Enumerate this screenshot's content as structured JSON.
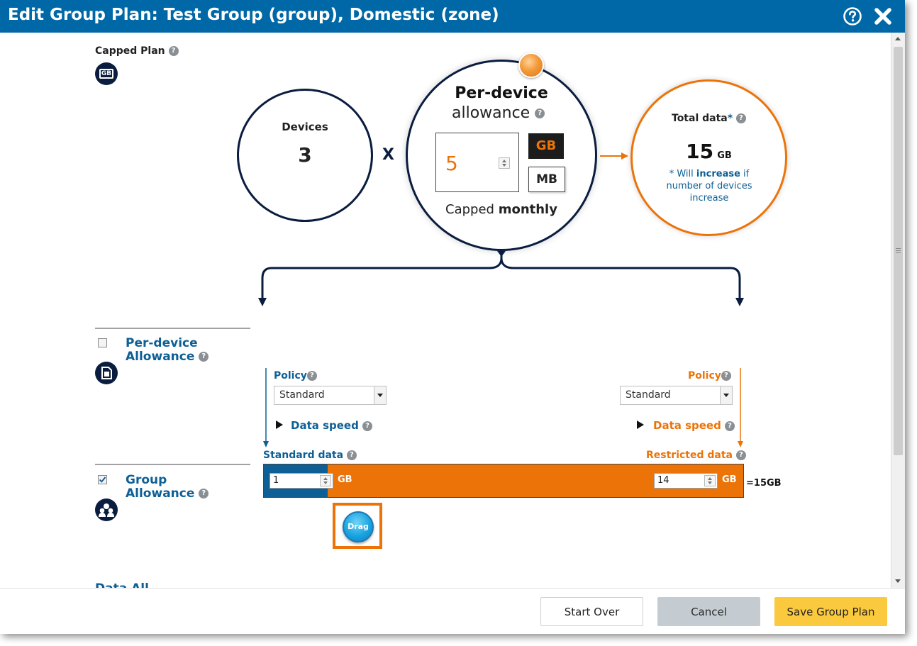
{
  "window": {
    "title": "Edit Group Plan: Test Group (group), Domestic (zone)"
  },
  "plan": {
    "type_label": "Capped Plan",
    "badge": "GB"
  },
  "devices": {
    "label": "Devices",
    "count": "3"
  },
  "operator": "X",
  "per_device": {
    "title": "Per-device",
    "subtitle": "allowance",
    "amount": "5",
    "unit_gb": "GB",
    "unit_mb": "MB",
    "period_prefix": "Capped",
    "period": "monthly"
  },
  "total": {
    "label": "Total data",
    "asterisk": "*",
    "value": "15",
    "unit": "GB",
    "note_prefix": "* Will",
    "note_bold": "increase",
    "note_suffix": "if number of devices increase"
  },
  "sections": {
    "per_device": {
      "line1": "Per-device",
      "line2": "Allowance",
      "checked": false
    },
    "group": {
      "line1": "Group",
      "line2": "Allowance",
      "checked": true
    },
    "cut_off": "Data All"
  },
  "standard": {
    "policy_label": "Policy",
    "policy_value": "Standard",
    "speed_label": "Data speed",
    "data_label": "Standard data",
    "amount": "1",
    "unit": "GB"
  },
  "restricted": {
    "policy_label": "Policy",
    "policy_value": "Standard",
    "speed_label": "Data speed",
    "data_label": "Restricted data",
    "amount": "14",
    "unit": "GB"
  },
  "bar": {
    "total_label": "=15GB",
    "drag_label": "Drag",
    "standard_share": 0.0667
  },
  "footer": {
    "start_over": "Start Over",
    "cancel": "Cancel",
    "save": "Save Group Plan"
  },
  "colors": {
    "header": "#0068a6",
    "blue": "#0d5f96",
    "orange": "#ec7308",
    "navy": "#0a1d3f",
    "save": "#fbc93d"
  }
}
